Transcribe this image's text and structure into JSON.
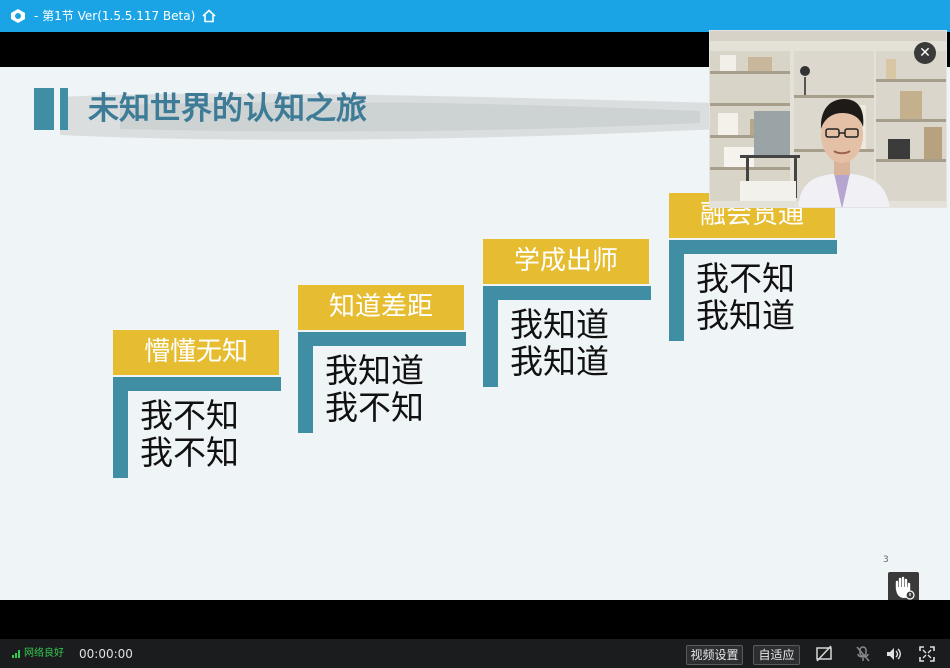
{
  "titlebar": {
    "title": "- 第1节 Ver(1.5.5.117 Beta)",
    "logo_icon": "app-logo-icon",
    "home_icon": "home-icon"
  },
  "slide": {
    "title": "未知世界的认知之旅",
    "steps": [
      {
        "label": "懵懂无知",
        "line1": "我不知",
        "line2": "我不知"
      },
      {
        "label": "知道差距",
        "line1": "我知道",
        "line2": "我不知"
      },
      {
        "label": "学成出师",
        "line1": "我知道",
        "line2": "我知道"
      },
      {
        "label": "融会贯通",
        "line1": "我不知",
        "line2": "我知道"
      }
    ],
    "page_number": "3",
    "colors": {
      "accent_blue": "#3f8ea4",
      "accent_gold": "#e6bd30",
      "title_color": "#3d7b96"
    }
  },
  "webcam": {
    "close_icon": "close-icon"
  },
  "bottombar": {
    "network_status": "网络良好",
    "timer": "00:00:00",
    "video_settings": "视频设置",
    "fit": "自适应",
    "icons": [
      "screen-off-icon",
      "mic-muted-icon",
      "speaker-icon",
      "fullscreen-icon"
    ]
  }
}
